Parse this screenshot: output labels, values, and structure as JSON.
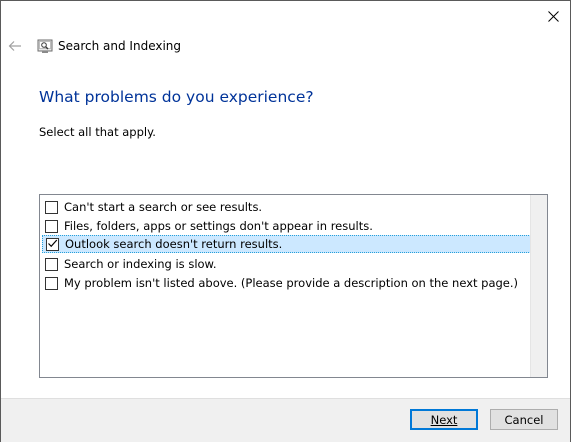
{
  "window": {
    "title": "Search and Indexing",
    "close_icon": "close-icon",
    "back_icon": "back-arrow-icon",
    "app_icon": "search-indexing-troubleshooter-icon"
  },
  "page": {
    "heading": "What problems do you experience?",
    "instruction": "Select all that apply."
  },
  "problems": [
    {
      "label": "Can't start a search or see results.",
      "checked": false
    },
    {
      "label": "Files, folders, apps or settings don't appear in results.",
      "checked": false
    },
    {
      "label": "Outlook search doesn't return results.",
      "checked": true
    },
    {
      "label": "Search or indexing is slow.",
      "checked": false
    },
    {
      "label": "My problem isn't listed above. (Please provide a description on the next page.)",
      "checked": false
    }
  ],
  "buttons": {
    "next": "Next",
    "cancel": "Cancel"
  },
  "colors": {
    "heading": "#003399",
    "selection": "#cce8ff",
    "footer": "#f0f0f0"
  }
}
